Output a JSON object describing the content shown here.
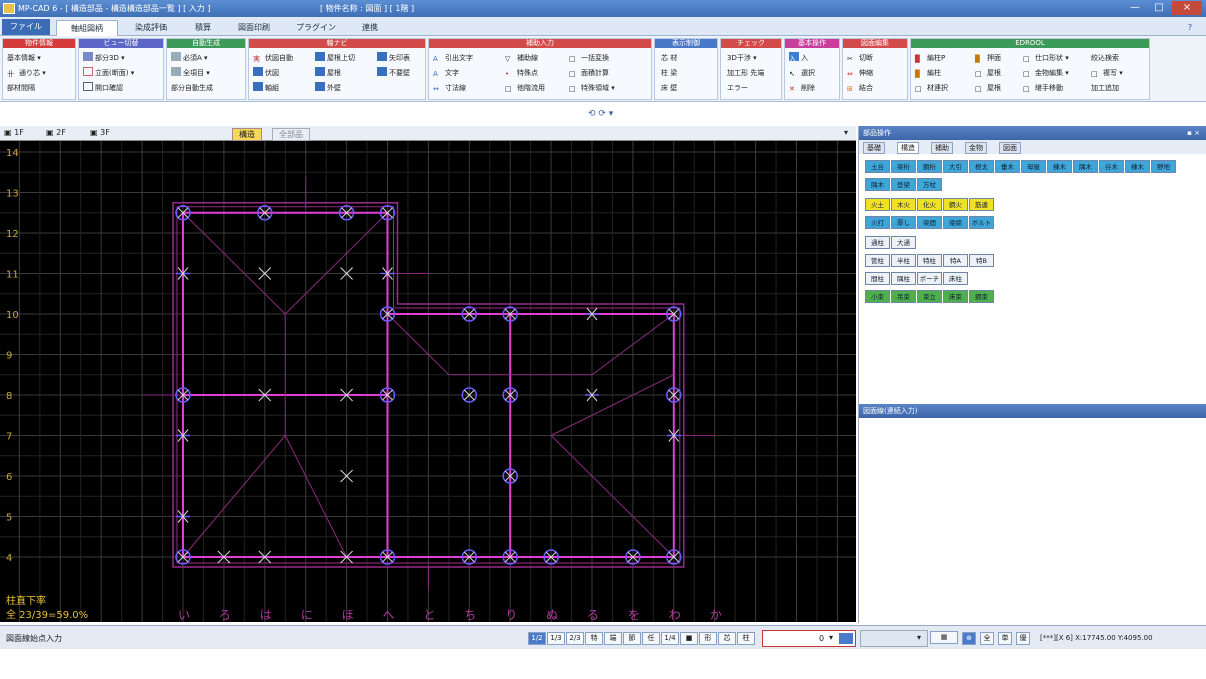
{
  "window": {
    "title": "MP-CAD 6 - [ 構造部品 - 構造構造部品一覧 ] [ 入力 ]",
    "center_title": "[ 物件名称 : 図面 ] [ 1階 ]",
    "controls": [
      "—",
      "□",
      "×"
    ]
  },
  "menu": {
    "tabs": [
      "ファイル",
      "軸組図柄",
      "染成評価",
      "積算",
      "図面印刷",
      "プラグイン",
      "連携"
    ],
    "help": "?"
  },
  "ribbon": {
    "groups": [
      {
        "title": "物件情報",
        "color": "#d43a3a",
        "col1": [
          "基本情報",
          "通り芯",
          "部材間隔"
        ]
      },
      {
        "title": "ビュー切替",
        "color": "#5b66c7",
        "col1": [
          "部分3D",
          "立面(断面)",
          "開口確認"
        ]
      },
      {
        "title": "自動生成",
        "color": "#3d9b5a",
        "col1": [
          "必須A",
          "全項目",
          "部分自動生成"
        ]
      },
      {
        "title": "軸ナビ",
        "color": "#d34a4a",
        "col1": [
          "伏図自動",
          "伏図",
          "軸組"
        ],
        "col2": [
          "屋根上切",
          "屋根",
          "外壁"
        ],
        "col3": [
          "矢印表",
          "不要壁"
        ]
      },
      {
        "title": "補助入力",
        "color": "#d34a4a",
        "col1": [
          "引出文字",
          "文字",
          "寸法線"
        ],
        "col2": [
          "補助線",
          "特殊点",
          "他階流用"
        ],
        "col3": [
          "一括変換",
          "面積計算",
          "特殊領域"
        ]
      },
      {
        "title": "表示制御",
        "color": "#4a78c9",
        "col1": [
          "芯",
          "材",
          "柱",
          "梁",
          "床",
          "壁"
        ]
      },
      {
        "title": "チェック",
        "color": "#d34a4a",
        "col1": [
          "3D干渉",
          "加工形",
          "エラー"
        ],
        "col2": [
          "先端"
        ]
      },
      {
        "title": "基本操作",
        "color": "#c93d9b",
        "col1": [
          "入",
          "選択",
          "削除"
        ]
      },
      {
        "title": "図面編集",
        "color": "#d34a4a",
        "col1": [
          "切断",
          "伸縮",
          "結合"
        ]
      },
      {
        "title": "EDROOL",
        "color": "#3d9b5a",
        "col1": [
          "編柱P",
          "編柱",
          "材連択"
        ],
        "col2": [
          "押面",
          "屋根",
          "屋根"
        ],
        "col3": [
          "仕口形状",
          "金物編集",
          "継手移動"
        ],
        "col4": [
          "絞込検索",
          "複写",
          "加工追加"
        ]
      }
    ]
  },
  "quick_access": "⟲ ⟳ ▾",
  "view": {
    "floor_tabs": [
      "1F",
      "2F",
      "3F"
    ],
    "mode_tabs": [
      "構造",
      "全部品"
    ],
    "dropdown": "▾"
  },
  "canvas": {
    "y_labels": [
      "14",
      "13",
      "12",
      "11",
      "10",
      "9",
      "8",
      "7",
      "6",
      "5",
      "4"
    ],
    "x_labels": [
      "い",
      "ろ",
      "は",
      "に",
      "ほ",
      "へ",
      "と",
      "ち",
      "り",
      "ぬ",
      "る",
      "を",
      "わ",
      "か"
    ],
    "status_line1": "柱直下率",
    "status_line2": "全 23/39=59.0%"
  },
  "statusbar": {
    "left_text": "図面線始点入力",
    "buttons": [
      "1/2",
      "1/3",
      "2/3",
      "特",
      "端",
      "節",
      "任",
      "1/4",
      "■",
      "形",
      "芯",
      "柱"
    ],
    "input_value": "0",
    "dropdown": "▾",
    "coords": "[***][X 6] X:17745.00 Y:4095.00",
    "mode_buttons": [
      "⊕",
      "全",
      "単",
      "優"
    ]
  },
  "rightpanel": {
    "title": "部品操作",
    "tabs": [
      "基礎",
      "構造",
      "補助",
      "金物",
      "図面"
    ],
    "buttons_row1": [
      "土台",
      "梁桁",
      "胴桁",
      "大引",
      "根太",
      "垂木",
      "母屋",
      "棟木",
      "隅木",
      "谷木",
      "棟木",
      "野地"
    ],
    "buttons_row2": [
      "隅木",
      "登梁",
      "方杖"
    ],
    "buttons_row3": [
      "火土",
      "木火",
      "化火",
      "鋼火",
      "筋違"
    ],
    "buttons_row4": [
      "火打",
      "厚し",
      "梁間",
      "梁締",
      "ボルト"
    ],
    "buttons_row5": [
      "通柱",
      "大通"
    ],
    "buttons_row6": [
      "管柱",
      "半柱",
      "特柱",
      "特A",
      "特B"
    ],
    "buttons_row7": [
      "間柱",
      "隅柱",
      "ポーチ",
      "床柱"
    ],
    "buttons_row8": [
      "小束",
      "吊束",
      "束立",
      "床束",
      "鋼束"
    ],
    "lower_title": "図面線(連続入力)"
  }
}
